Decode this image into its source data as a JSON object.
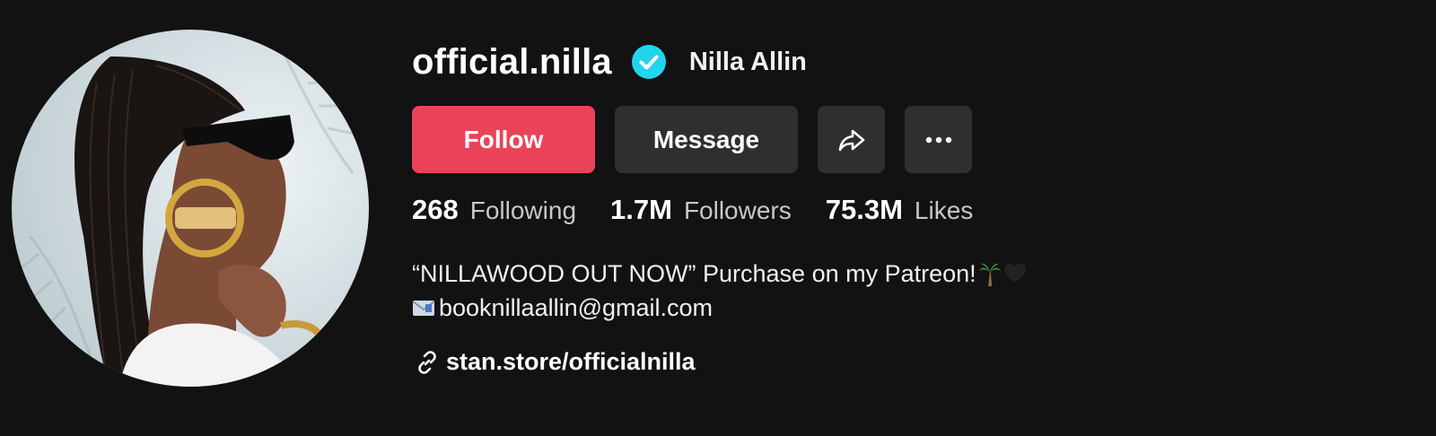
{
  "profile": {
    "username": "official.nilla",
    "display_name": "Nilla Allin",
    "verified": true,
    "avatar_alt": "profile-photo"
  },
  "actions": {
    "follow_label": "Follow",
    "message_label": "Message",
    "share_icon": "share-arrow-icon",
    "more_icon": "more-dots-icon"
  },
  "stats": [
    {
      "value": "268",
      "label": "Following"
    },
    {
      "value": "1.7M",
      "label": "Followers"
    },
    {
      "value": "75.3M",
      "label": "Likes"
    }
  ],
  "bio": {
    "line1": "“NILLAWOOD OUT NOW” Purchase on my Patreon!",
    "line2": "booknillaallin@gmail.com"
  },
  "link": {
    "text": "stan.store/officialnilla"
  },
  "colors": {
    "background": "#121212",
    "follow": "#ea4359",
    "secondary_button": "#2f2f2f",
    "verified": "#20d5ec"
  }
}
